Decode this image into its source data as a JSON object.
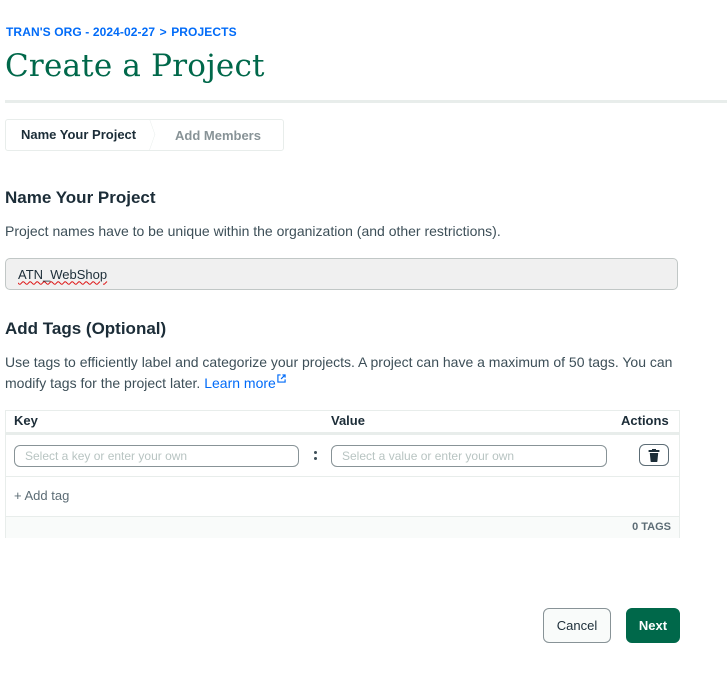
{
  "breadcrumb": {
    "org": "TRAN'S ORG - 2024-02-27",
    "separator": ">",
    "section": "PROJECTS"
  },
  "page_title": "Create a Project",
  "stepper": {
    "steps": [
      {
        "label": "Name Your Project",
        "active": true
      },
      {
        "label": "Add Members",
        "active": false
      }
    ]
  },
  "name_section": {
    "title": "Name Your Project",
    "description": "Project names have to be unique within the organization (and other restrictions).",
    "input_value": "ATN_WebShop"
  },
  "tags_section": {
    "title": "Add Tags (Optional)",
    "description": "Use tags to efficiently label and categorize your projects. A project can have a maximum of 50 tags. You can modify tags for the project later.",
    "learn_more": "Learn more",
    "table": {
      "headers": {
        "key": "Key",
        "value": "Value",
        "actions": "Actions"
      },
      "key_placeholder": "Select a key or enter your own",
      "value_placeholder": "Select a value or enter your own",
      "add_tag_label": "+ Add tag",
      "tag_count": "0 TAGS"
    }
  },
  "footer": {
    "cancel_label": "Cancel",
    "next_label": "Next"
  },
  "colors": {
    "accent_green": "#00684a",
    "link_blue": "#016bf8"
  }
}
